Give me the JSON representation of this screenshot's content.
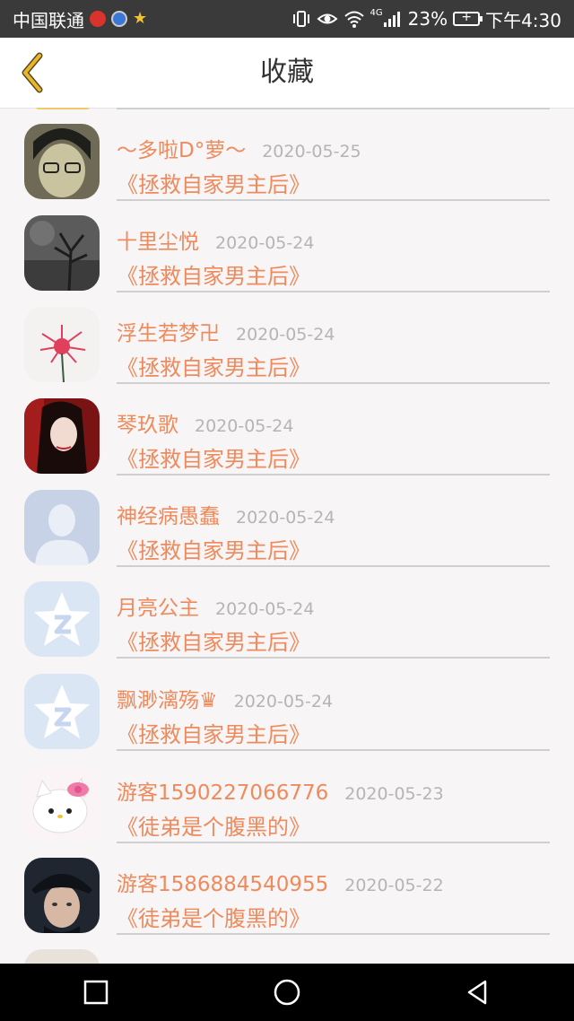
{
  "status_bar": {
    "carrier": "中国联通",
    "network": "4G",
    "battery": "23%",
    "time": "下午4:30"
  },
  "header": {
    "title": "收藏"
  },
  "colors": {
    "accent": "#ef8a5c",
    "date": "#b5b5b5",
    "back_icon": "#e8b72c"
  },
  "rows": [
    {
      "name": "～多啦D°萝～",
      "date": "2020-05-25",
      "book": "《拯救自家男主后》",
      "avatar_icon": "user-photo-glasses"
    },
    {
      "name": "十里尘悦",
      "date": "2020-05-24",
      "book": "《拯救自家男主后》",
      "avatar_icon": "user-photo-tree"
    },
    {
      "name": "浮生若梦卍",
      "date": "2020-05-24",
      "book": "《拯救自家男主后》",
      "avatar_icon": "user-photo-flower"
    },
    {
      "name": "琴玖歌",
      "date": "2020-05-24",
      "book": "《拯救自家男主后》",
      "avatar_icon": "user-photo-red"
    },
    {
      "name": "神经病愚蠢",
      "date": "2020-05-24",
      "book": "《拯救自家男主后》",
      "avatar_icon": "default-user-silhouette"
    },
    {
      "name": "月亮公主",
      "date": "2020-05-24",
      "book": "《拯救自家男主后》",
      "avatar_icon": "qzone-star-logo"
    },
    {
      "name": "飘渺漓殇♛",
      "date": "2020-05-24",
      "book": "《拯救自家男主后》",
      "avatar_icon": "qzone-star-logo"
    },
    {
      "name": "游客1590227066776",
      "date": "2020-05-23",
      "book": "《徒弟是个腹黑的》",
      "avatar_icon": "user-photo-hellokitty"
    },
    {
      "name": "游客1586884540955",
      "date": "2020-05-22",
      "book": "《徒弟是个腹黑的》",
      "avatar_icon": "user-photo-man-cap"
    }
  ]
}
